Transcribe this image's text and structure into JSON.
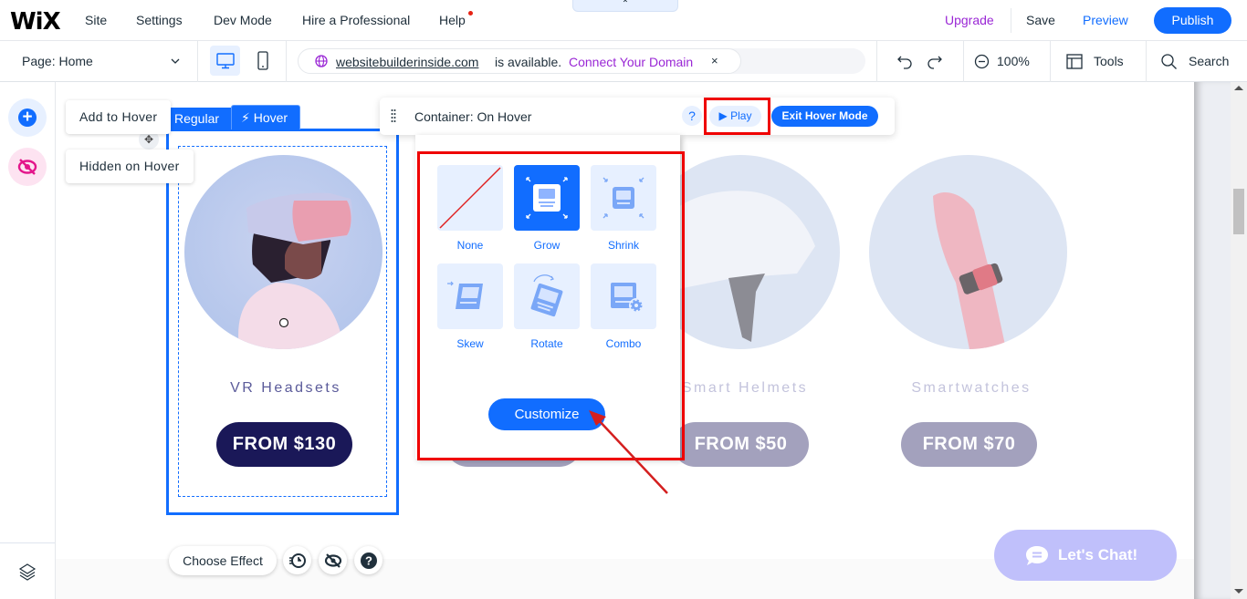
{
  "topbar": {
    "logo": "WiX",
    "nav": [
      "Site",
      "Settings",
      "Dev Mode",
      "Hire a Professional",
      "Help"
    ],
    "collapse_icon": "chevron-up-icon",
    "upgrade": "Upgrade",
    "save": "Save",
    "preview": "Preview",
    "publish": "Publish"
  },
  "toolbar": {
    "page_select": "Page: Home",
    "device_desktop": "desktop-icon",
    "device_mobile": "mobile-icon",
    "domain": {
      "link": "websitebuilderinside.com",
      "status": "is available.",
      "connect": "Connect Your Domain",
      "close": "×"
    },
    "zoom": "100%",
    "tools": "Tools",
    "search": "Search"
  },
  "left_rail": {
    "add_icon": "add-icon",
    "hidden_icon": "hidden-eye-icon",
    "layers_icon": "layers-icon"
  },
  "tooltips": {
    "add_to_hover": "Add to Hover",
    "hidden_on_hover": "Hidden on Hover"
  },
  "state_tabs": {
    "regular": "Regular",
    "hover": "Hover"
  },
  "hover_toolbar": {
    "title": "Container: On Hover",
    "help": "?",
    "play": "Play",
    "exit": "Exit Hover Mode"
  },
  "effects_panel": {
    "effects": [
      {
        "label": "None",
        "selected": false
      },
      {
        "label": "Grow",
        "selected": true
      },
      {
        "label": "Shrink",
        "selected": false
      },
      {
        "label": "Skew",
        "selected": false
      },
      {
        "label": "Rotate",
        "selected": false
      },
      {
        "label": "Combo",
        "selected": false
      }
    ],
    "customize": "Customize"
  },
  "products": [
    {
      "title": "VR Headsets",
      "price": "FROM $130",
      "price_color": "#1a1858"
    },
    {
      "title": "Smart Helmets",
      "price": "FROM $50",
      "price_color": "#a3a1bd"
    },
    {
      "title": "Smartwatches",
      "price": "FROM $70",
      "price_color": "#a3a1bd"
    }
  ],
  "bottom_bar": {
    "choose_effect": "Choose Effect"
  },
  "chat": {
    "label": "Let's Chat!"
  },
  "colors": {
    "accent": "#116dff",
    "upgrade": "#9a27d5",
    "annotation": "#ef0000"
  }
}
